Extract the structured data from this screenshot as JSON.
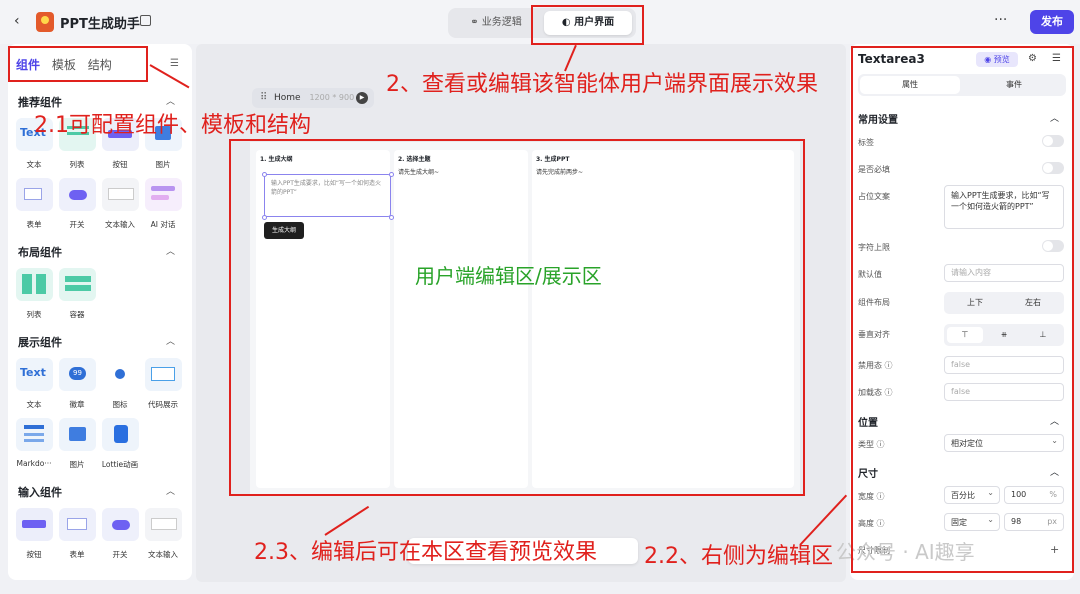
{
  "header": {
    "title": "PPT生成助手",
    "tabs": [
      {
        "label": "业务逻辑"
      },
      {
        "label": "用户界面"
      }
    ],
    "more": "···",
    "publish": "发布"
  },
  "left_panel": {
    "tabs": [
      "组件",
      "模板",
      "结构"
    ],
    "sections": [
      {
        "title": "推荐组件",
        "items": [
          "文本",
          "列表",
          "按钮",
          "图片",
          "表单",
          "开关",
          "文本输入",
          "AI 对话"
        ]
      },
      {
        "title": "布局组件",
        "items": [
          "列表",
          "容器"
        ]
      },
      {
        "title": "展示组件",
        "items": [
          "文本",
          "徽章",
          "图标",
          "代码展示",
          "Markdo···",
          "图片",
          "Lottie动画"
        ]
      },
      {
        "title": "输入组件",
        "items": [
          "按钮",
          "表单",
          "开关",
          "文本输入"
        ]
      }
    ]
  },
  "canvas": {
    "page_name": "Home",
    "page_size": "1200 * 900",
    "columns": [
      {
        "title": "1. 生成大纲",
        "placeholder": "输入PPT生成要求，比如“写一个如何造火箭的PPT”",
        "button": "生成大纲"
      },
      {
        "title": "2. 选择主题",
        "subtitle": "请先生成大纲~"
      },
      {
        "title": "3. 生成PPT",
        "subtitle": "请先完成前两步~"
      }
    ],
    "region_label": "用户端编辑区/展示区"
  },
  "right_panel": {
    "component": "Textarea3",
    "preview": "预览",
    "tabs": [
      "属性",
      "事件"
    ],
    "common": {
      "title": "常用设置",
      "label": "标签",
      "required": "是否必填",
      "placeholder_label": "占位文案",
      "placeholder_value": "输入PPT生成要求，比如“写一个如何造火箭的PPT”",
      "maxlen": "字符上限",
      "default_label": "默认值",
      "default_ph": "请输入内容",
      "layout_label": "组件布局",
      "layout_opts": [
        "上下",
        "左右"
      ],
      "valign_label": "垂直对齐",
      "disabled_label": "禁用态",
      "disabled_val": "false",
      "loading_label": "加载态",
      "loading_val": "false"
    },
    "position": {
      "title": "位置",
      "type_label": "类型",
      "type_val": "相对定位"
    },
    "size": {
      "title": "尺寸",
      "width_label": "宽度",
      "width_mode": "百分比",
      "width_val": "100",
      "width_unit": "%",
      "height_label": "高度",
      "height_mode": "固定",
      "height_val": "98",
      "height_unit": "px",
      "size_limit": "尺寸限制"
    }
  },
  "annotations": {
    "a1": "2、查看或编辑该智能体用户端界面展示效果",
    "a2": "2.1可配置组件、模板和结构",
    "a3": "2.3、编辑后可在本区查看预览效果",
    "a4": "2.2、右侧为编辑区"
  },
  "watermark": "公众号 · AI趣享",
  "colors": {
    "accent": "#4e44e8",
    "annotation": "#e0211d",
    "region_text": "#29a329"
  }
}
